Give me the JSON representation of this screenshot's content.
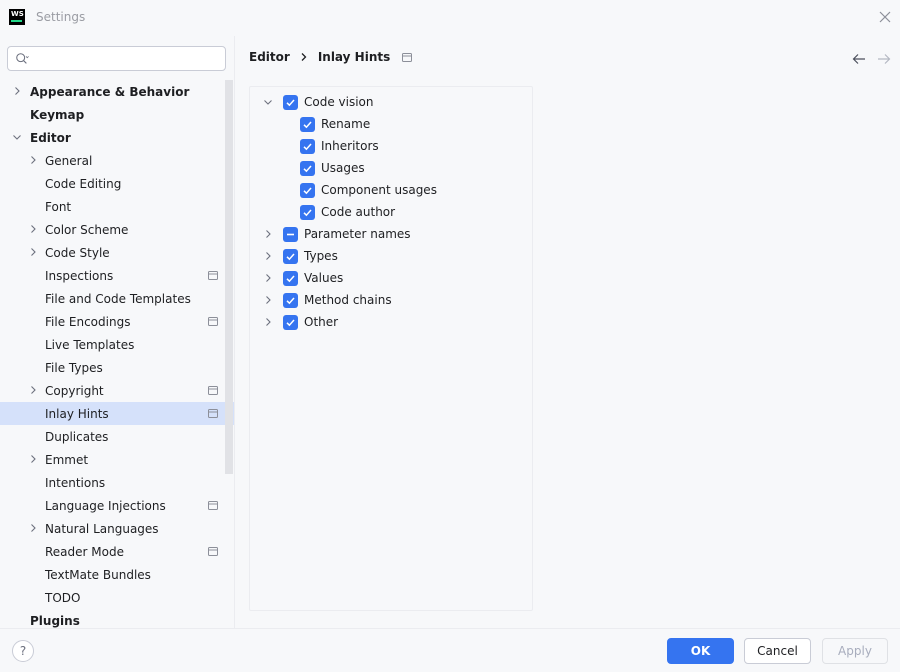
{
  "window": {
    "title": "Settings",
    "app_logo_text": "WS"
  },
  "search": {
    "value": "",
    "placeholder": ""
  },
  "sidebar": {
    "items": [
      {
        "label": "Appearance & Behavior",
        "level": 0,
        "expandable": true,
        "expanded": false,
        "scoped": false,
        "selected": false
      },
      {
        "label": "Keymap",
        "level": 0,
        "expandable": false,
        "expanded": false,
        "scoped": false,
        "selected": false
      },
      {
        "label": "Editor",
        "level": 0,
        "expandable": true,
        "expanded": true,
        "scoped": false,
        "selected": false
      },
      {
        "label": "General",
        "level": 1,
        "expandable": true,
        "expanded": false,
        "scoped": false,
        "selected": false
      },
      {
        "label": "Code Editing",
        "level": 1,
        "expandable": false,
        "expanded": false,
        "scoped": false,
        "selected": false
      },
      {
        "label": "Font",
        "level": 1,
        "expandable": false,
        "expanded": false,
        "scoped": false,
        "selected": false
      },
      {
        "label": "Color Scheme",
        "level": 1,
        "expandable": true,
        "expanded": false,
        "scoped": false,
        "selected": false
      },
      {
        "label": "Code Style",
        "level": 1,
        "expandable": true,
        "expanded": false,
        "scoped": false,
        "selected": false
      },
      {
        "label": "Inspections",
        "level": 1,
        "expandable": false,
        "expanded": false,
        "scoped": true,
        "selected": false
      },
      {
        "label": "File and Code Templates",
        "level": 1,
        "expandable": false,
        "expanded": false,
        "scoped": false,
        "selected": false
      },
      {
        "label": "File Encodings",
        "level": 1,
        "expandable": false,
        "expanded": false,
        "scoped": true,
        "selected": false
      },
      {
        "label": "Live Templates",
        "level": 1,
        "expandable": false,
        "expanded": false,
        "scoped": false,
        "selected": false
      },
      {
        "label": "File Types",
        "level": 1,
        "expandable": false,
        "expanded": false,
        "scoped": false,
        "selected": false
      },
      {
        "label": "Copyright",
        "level": 1,
        "expandable": true,
        "expanded": false,
        "scoped": true,
        "selected": false
      },
      {
        "label": "Inlay Hints",
        "level": 1,
        "expandable": false,
        "expanded": false,
        "scoped": true,
        "selected": true
      },
      {
        "label": "Duplicates",
        "level": 1,
        "expandable": false,
        "expanded": false,
        "scoped": false,
        "selected": false
      },
      {
        "label": "Emmet",
        "level": 1,
        "expandable": true,
        "expanded": false,
        "scoped": false,
        "selected": false
      },
      {
        "label": "Intentions",
        "level": 1,
        "expandable": false,
        "expanded": false,
        "scoped": false,
        "selected": false
      },
      {
        "label": "Language Injections",
        "level": 1,
        "expandable": false,
        "expanded": false,
        "scoped": true,
        "selected": false
      },
      {
        "label": "Natural Languages",
        "level": 1,
        "expandable": true,
        "expanded": false,
        "scoped": false,
        "selected": false
      },
      {
        "label": "Reader Mode",
        "level": 1,
        "expandable": false,
        "expanded": false,
        "scoped": true,
        "selected": false
      },
      {
        "label": "TextMate Bundles",
        "level": 1,
        "expandable": false,
        "expanded": false,
        "scoped": false,
        "selected": false
      },
      {
        "label": "TODO",
        "level": 1,
        "expandable": false,
        "expanded": false,
        "scoped": false,
        "selected": false
      },
      {
        "label": "Plugins",
        "level": 0,
        "expandable": false,
        "expanded": false,
        "scoped": false,
        "selected": false
      }
    ]
  },
  "breadcrumb": {
    "parent": "Editor",
    "current": "Inlay Hints"
  },
  "hints": {
    "items": [
      {
        "label": "Code vision",
        "level": 0,
        "expandable": true,
        "expanded": true,
        "state": "checked"
      },
      {
        "label": "Rename",
        "level": 1,
        "expandable": false,
        "expanded": false,
        "state": "checked"
      },
      {
        "label": "Inheritors",
        "level": 1,
        "expandable": false,
        "expanded": false,
        "state": "checked"
      },
      {
        "label": "Usages",
        "level": 1,
        "expandable": false,
        "expanded": false,
        "state": "checked"
      },
      {
        "label": "Component usages",
        "level": 1,
        "expandable": false,
        "expanded": false,
        "state": "checked"
      },
      {
        "label": "Code author",
        "level": 1,
        "expandable": false,
        "expanded": false,
        "state": "checked"
      },
      {
        "label": "Parameter names",
        "level": 0,
        "expandable": true,
        "expanded": false,
        "state": "indeterminate"
      },
      {
        "label": "Types",
        "level": 0,
        "expandable": true,
        "expanded": false,
        "state": "checked"
      },
      {
        "label": "Values",
        "level": 0,
        "expandable": true,
        "expanded": false,
        "state": "checked"
      },
      {
        "label": "Method chains",
        "level": 0,
        "expandable": true,
        "expanded": false,
        "state": "checked"
      },
      {
        "label": "Other",
        "level": 0,
        "expandable": true,
        "expanded": false,
        "state": "checked"
      }
    ]
  },
  "footer": {
    "help_label": "?",
    "ok_label": "OK",
    "cancel_label": "Cancel",
    "apply_label": "Apply",
    "apply_enabled": false
  },
  "colors": {
    "accent": "#3574f0",
    "selection": "#d5e1fa"
  }
}
